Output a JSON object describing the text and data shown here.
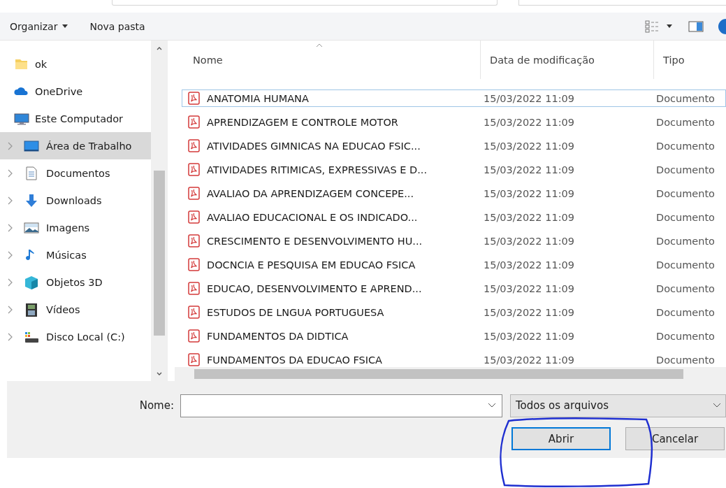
{
  "toolbar": {
    "buttons": [
      {
        "label": "Organizar",
        "menu": true
      },
      {
        "label": "Nova pasta",
        "menu": false
      }
    ]
  },
  "sidebar": {
    "items": [
      {
        "label": "ok",
        "kind": "folder",
        "selected": false
      },
      {
        "label": "OneDrive",
        "kind": "cloud",
        "selected": false
      },
      {
        "label": "Este Computador",
        "kind": "computer",
        "selected": false,
        "children": [
          {
            "label": "Área de Trabalho",
            "kind": "desktop",
            "selected": true
          },
          {
            "label": "Documentos",
            "kind": "documents",
            "selected": false
          },
          {
            "label": "Downloads",
            "kind": "downloads",
            "selected": false
          },
          {
            "label": "Imagens",
            "kind": "pictures",
            "selected": false
          },
          {
            "label": "Músicas",
            "kind": "music",
            "selected": false
          },
          {
            "label": "Objetos 3D",
            "kind": "objects3d",
            "selected": false
          },
          {
            "label": "Vídeos",
            "kind": "videos",
            "selected": false
          },
          {
            "label": "Disco Local (C:)",
            "kind": "drive",
            "selected": false
          }
        ]
      }
    ]
  },
  "table": {
    "columns": [
      {
        "label": "Nome",
        "sorted": true
      },
      {
        "label": "Data de modificação",
        "sorted": false
      },
      {
        "label": "Tipo",
        "sorted": false
      }
    ],
    "rows": [
      {
        "name": "ANATOMIA HUMANA",
        "date": "15/03/2022 11:09",
        "type": "Documento",
        "focused": true
      },
      {
        "name": "APRENDIZAGEM E CONTROLE MOTOR",
        "date": "15/03/2022 11:09",
        "type": "Documento",
        "focused": false
      },
      {
        "name": "ATIVIDADES GIMNICAS NA EDUCAO FSIC...",
        "date": "15/03/2022 11:09",
        "type": "Documento",
        "focused": false
      },
      {
        "name": "ATIVIDADES RITIMICAS, EXPRESSIVAS E D...",
        "date": "15/03/2022 11:09",
        "type": "Documento",
        "focused": false
      },
      {
        "name": "AVALIAO DA APRENDIZAGEM CONCEPE...",
        "date": "15/03/2022 11:09",
        "type": "Documento",
        "focused": false
      },
      {
        "name": "AVALIAO EDUCACIONAL E OS INDICADO...",
        "date": "15/03/2022 11:09",
        "type": "Documento",
        "focused": false
      },
      {
        "name": "CRESCIMENTO E DESENVOLVIMENTO HU...",
        "date": "15/03/2022 11:09",
        "type": "Documento",
        "focused": false
      },
      {
        "name": "DOCNCIA E PESQUISA EM EDUCAO FSICA",
        "date": "15/03/2022 11:09",
        "type": "Documento",
        "focused": false
      },
      {
        "name": "EDUCAO, DESENVOLVIMENTO E APREND...",
        "date": "15/03/2022 11:09",
        "type": "Documento",
        "focused": false
      },
      {
        "name": "ESTUDOS DE LNGUA PORTUGUESA",
        "date": "15/03/2022 11:09",
        "type": "Documento",
        "focused": false
      },
      {
        "name": "FUNDAMENTOS DA DIDTICA",
        "date": "15/03/2022 11:09",
        "type": "Documento",
        "focused": false
      },
      {
        "name": "FUNDAMENTOS DA EDUCAO FSICA",
        "date": "15/03/2022 11:09",
        "type": "Documento",
        "focused": false
      }
    ]
  },
  "footer": {
    "name_label": "Nome:",
    "filter": "Todos os arquivos",
    "buttons": [
      {
        "label": "Abrir",
        "default": true
      },
      {
        "label": "Cancelar",
        "default": false
      }
    ]
  },
  "annotation": {
    "kind": "circle"
  }
}
